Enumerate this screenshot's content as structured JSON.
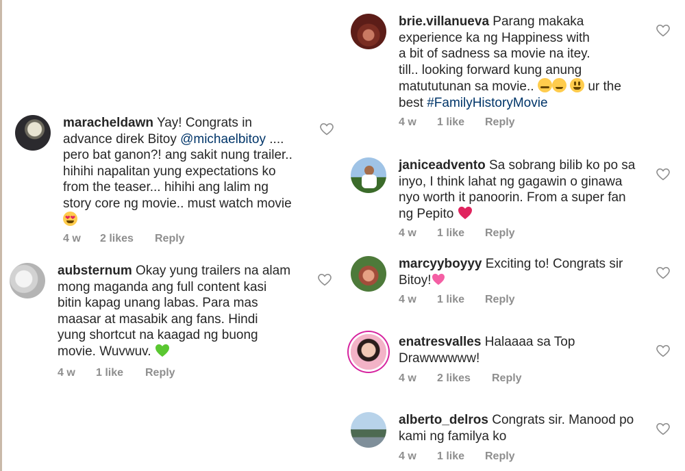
{
  "comments": [
    {
      "username": "maracheldawn",
      "lines": [
        "Yay! Congrats in",
        "advance direk Bitoy ",
        "pero bat ganon?! ang sakit nung trailer..",
        "hihihi napalitan yung expectations ko",
        "from the teaser... hihihi ang lalim ng",
        "story core ng movie.. must watch movie"
      ],
      "mention": "@michaelbitoy",
      "after_mention": " ....",
      "time": "4 w",
      "likes": "2 likes",
      "reply": "Reply"
    },
    {
      "username": "aubsternum",
      "lines": [
        "Okay yung trailers na alam",
        "mong maganda ang full content kasi",
        "bitin kapag unang labas. Para mas",
        "maasar at masabik ang fans. Hindi",
        "yung shortcut na kaagad ng buong",
        "movie. Wuvwuv."
      ],
      "time": "4 w",
      "likes": "1 like",
      "reply": "Reply"
    },
    {
      "username": "brie.villanueva",
      "lines": [
        "Parang makaka",
        "experience ka ng Happiness with",
        "a bit of sadness sa movie na itey.",
        "till.. looking forward kung anung",
        "matututunan sa movie..",
        "best "
      ],
      "after_emojis": " ur the",
      "hashtag": "#FamilyHistoryMovie",
      "time": "4 w",
      "likes": "1 like",
      "reply": "Reply"
    },
    {
      "username": "janiceadvento",
      "lines": [
        "Sa sobrang bilib ko po sa",
        "inyo, I think lahat ng gagawin o ginawa",
        "nyo worth it panoorin. From a super fan",
        "ng Pepito"
      ],
      "time": "4 w",
      "likes": "1 like",
      "reply": "Reply"
    },
    {
      "username": "marcyyboyyy",
      "lines": [
        "Exciting to! Congrats sir",
        "Bitoy!"
      ],
      "time": "4 w",
      "likes": "1 like",
      "reply": "Reply"
    },
    {
      "username": "enatresvalles",
      "lines": [
        "Halaaaa sa Top",
        "Drawwwwww!"
      ],
      "time": "4 w",
      "likes": "2 likes",
      "reply": "Reply"
    },
    {
      "username": "alberto_delros",
      "lines": [
        "Congrats sir. Manood po",
        "kami ng familya ko"
      ],
      "time": "4 w",
      "likes": "1 like",
      "reply": "Reply"
    }
  ],
  "colors": {
    "text": "#262626",
    "meta": "#8e8e8e",
    "link": "#003569",
    "heart_outline": "#8e8e8e",
    "red_heart": "#e0245e",
    "green_heart": "#5ac731",
    "pink_heart": "#f45fa4"
  }
}
